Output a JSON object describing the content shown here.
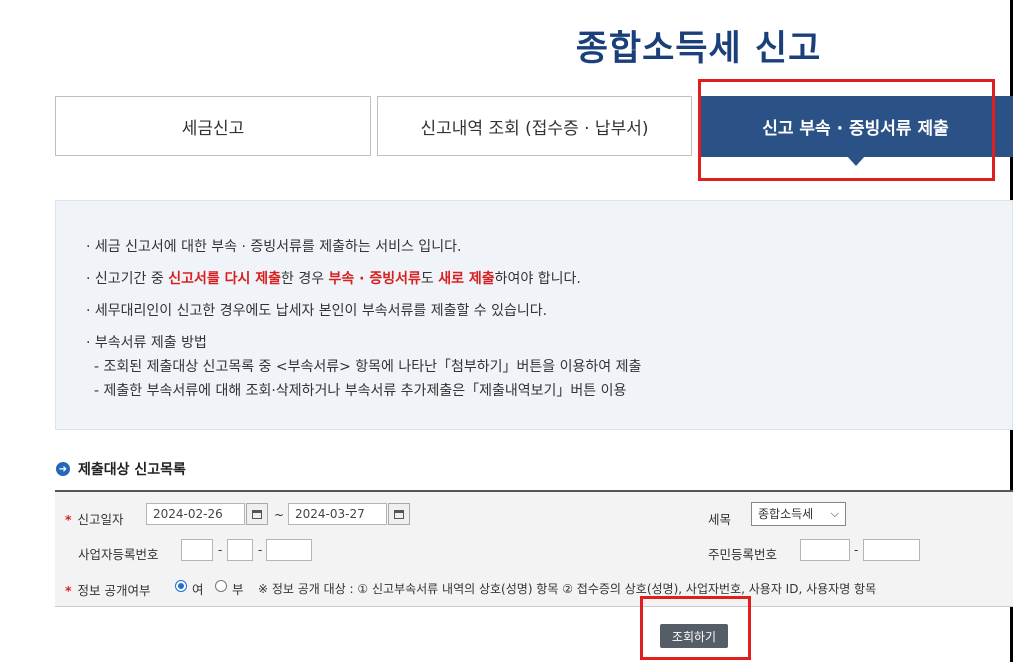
{
  "page_title": "종합소득세 신고",
  "tabs": [
    {
      "label": "세금신고"
    },
    {
      "label": "신고내역 조회 (접수증 · 납부서)"
    },
    {
      "label": "신고 부속 · 증빙서류 제출"
    }
  ],
  "info": {
    "line1": "· 세금 신고서에 대한 부속 · 증빙서류를 제출하는 서비스 입니다.",
    "line2_a": "· 신고기간 중 ",
    "line2_b": "신고서를 다시 제출",
    "line2_c": "한 경우 ",
    "line2_d": "부속 · 증빙서류",
    "line2_e": "도 ",
    "line2_f": "새로 제출",
    "line2_g": "하여야 합니다.",
    "line3": "· 세무대리인이 신고한 경우에도 납세자 본인이 부속서류를 제출할 수 있습니다.",
    "line4": "· 부속서류 제출 방법",
    "sub1": "- 조회된 제출대상 신고목록 중 <부속서류> 항목에 나타난「첨부하기」버튼을 이용하여 제출",
    "sub2": "- 제출한 부속서류에 대해 조회·삭제하거나 부속서류 추가제출은「제출내역보기」버튼 이용"
  },
  "section_title": "제출대상 신고목록",
  "form": {
    "star": "*",
    "report_date_label": "신고일자",
    "date_from": "2024-02-26",
    "date_to": "2024-03-27",
    "tilde": "~",
    "tax_item_label": "세목",
    "tax_item_value": "종합소득세",
    "biz_no_label": "사업자등록번호",
    "resident_no_label": "주민등록번호",
    "dash": "-",
    "disclosure_label": "정보 공개여부",
    "radio_yes": "여",
    "radio_no": "부",
    "disclosure_note": "※ 정보 공개 대상 : ① 신고부속서류 내역의 상호(성명) 항목 ② 접수증의 상호(성명), 사업자번호, 사용자 ID, 사용자명 항목",
    "disclosure_selected": "여"
  },
  "search_button": "조회하기",
  "colors": {
    "title": "#1b3f7a",
    "active_tab": "#2b5286",
    "highlight": "#d81f1f",
    "annotation_box": "#e01e1e"
  },
  "icons": {
    "calendar": "calendar-icon",
    "section": "arrow-circle-icon",
    "select": "chevron-down-icon"
  }
}
